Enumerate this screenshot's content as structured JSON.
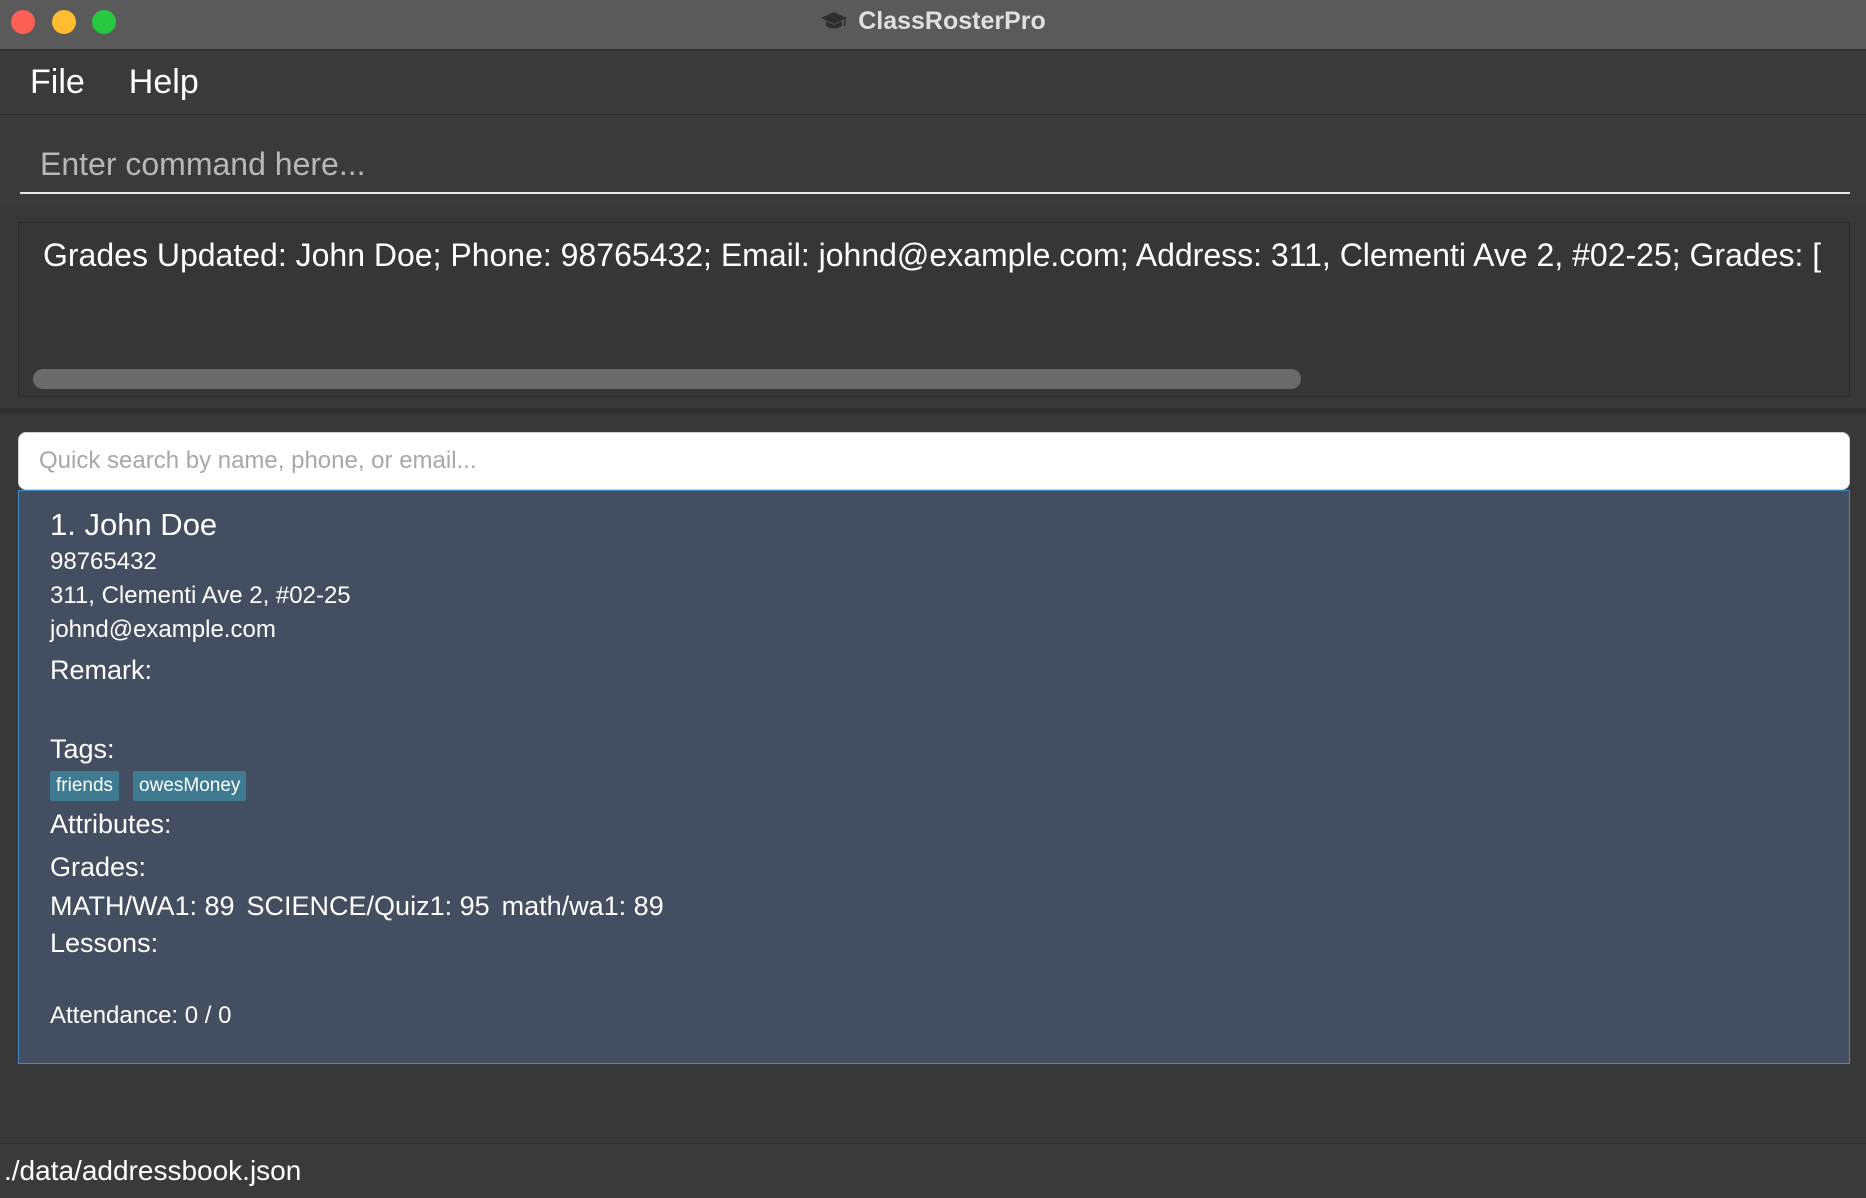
{
  "window": {
    "title": "ClassRosterPro",
    "icons": {
      "app": "graduation-cap-icon"
    }
  },
  "menu": {
    "items": [
      "File",
      "Help"
    ]
  },
  "command": {
    "placeholder": "Enter command here...",
    "value": ""
  },
  "result": {
    "text": "Grades Updated: John Doe; Phone: 98765432; Email: johnd@example.com; Address: 311, Clementi Ave 2, #02-25; Grades: ["
  },
  "search": {
    "placeholder": "Quick search by name, phone, or email..."
  },
  "persons": [
    {
      "index_name": "1. John Doe",
      "phone": "98765432",
      "address": "311, Clementi Ave 2, #02-25",
      "email": "johnd@example.com",
      "remark_label": "Remark:",
      "remark": "",
      "tags_label": "Tags:",
      "tags": [
        "friends",
        "owesMoney"
      ],
      "attributes_label": "Attributes:",
      "grades_label": "Grades:",
      "grades": [
        "MATH/WA1: 89",
        "SCIENCE/Quiz1: 95",
        "math/wa1: 89"
      ],
      "lessons_label": "Lessons:",
      "attendance": "Attendance: 0 / 0"
    }
  ],
  "status": {
    "path": "./data/addressbook.json"
  },
  "colors": {
    "titlebar": "#5a5a5a",
    "background": "#383838",
    "card": "#434f61",
    "card_border": "#3c8ec2",
    "tag": "#3e7b91",
    "close": "#fe5f57",
    "minimize": "#febc2e",
    "maximize": "#28c840"
  }
}
